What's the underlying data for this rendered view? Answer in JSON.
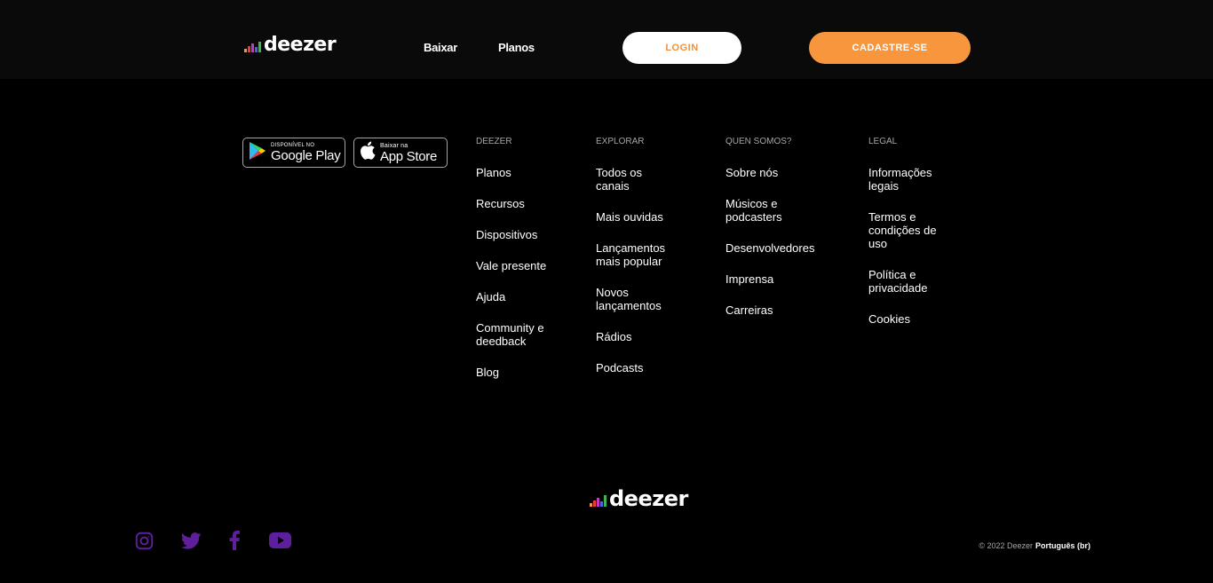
{
  "header": {
    "logo": "deezer",
    "nav": {
      "download": "Baixar",
      "plans": "Planos"
    },
    "login_label": "LOGIN",
    "signup_label": "CADASTRE-SE"
  },
  "stores": {
    "google": {
      "small": "DISPONÍVEL NO",
      "big": "Google Play"
    },
    "apple": {
      "small": "Baixar na",
      "big": "App Store"
    }
  },
  "footer": {
    "columns": [
      {
        "heading": "DEEZER",
        "items": [
          "Planos",
          "Recursos",
          "Dispositivos",
          "Vale presente",
          "Ajuda",
          "Community e deedback",
          "Blog"
        ]
      },
      {
        "heading": "EXPLORAR",
        "items": [
          "Todos os canais",
          "Mais ouvidas",
          "Lançamentos mais popular",
          "Novos lançamentos",
          "Rádios",
          "Podcasts"
        ]
      },
      {
        "heading": "QUEN SOMOS?",
        "items": [
          "Sobre nós",
          "Músicos e podcasters",
          "Desenvolvedores",
          "Imprensa",
          "Carreiras"
        ]
      },
      {
        "heading": "LEGAL",
        "items": [
          "Informações legais",
          "Termos e condições de uso",
          "Política e privacidade",
          "Cookies"
        ]
      }
    ],
    "logo": "deezer",
    "social": [
      "instagram-icon",
      "twitter-icon",
      "facebook-icon",
      "youtube-icon"
    ],
    "copyright": "© 2022 Deezer",
    "language": "Português (br)"
  },
  "colors": {
    "accent": "#f7963c",
    "social": "#5e1e9e",
    "logo_bars": [
      "#f7963c",
      "#e93c3c",
      "#c637c6",
      "#4267e6",
      "#40b354"
    ]
  }
}
